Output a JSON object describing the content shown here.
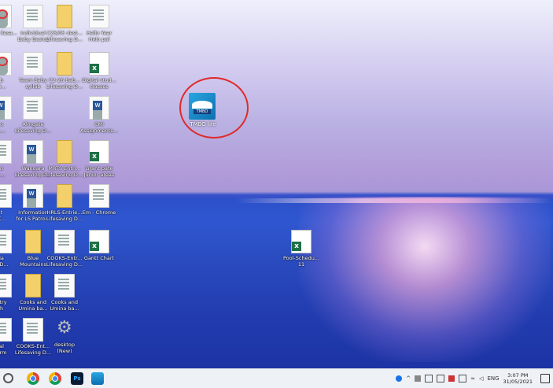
{
  "desktop": {
    "icons": [
      {
        "label": "Blu... ilesa...",
        "type": "pdf",
        "col": 0,
        "row": 0
      },
      {
        "label": "Individual\nBaby Basics",
        "type": "doc",
        "col": 1,
        "row": 0
      },
      {
        "label": "C25/05 dest...\nLifesaving D...",
        "type": "folder",
        "col": 2,
        "row": 0
      },
      {
        "label": "Hello Year\nHelo pal",
        "type": "doc",
        "col": 3,
        "row": 0
      },
      {
        "label": "b\nG...",
        "type": "pdf",
        "col": 0,
        "row": 1
      },
      {
        "label": "Team Baby\nsyllab",
        "type": "doc",
        "col": 1,
        "row": 1
      },
      {
        "label": "C2-26 Bab...\nLifesaving D...",
        "type": "folder",
        "col": 2,
        "row": 1
      },
      {
        "label": "Digital stud...\nclasses",
        "type": "xls",
        "col": 3,
        "row": 1
      },
      {
        "label": "o\nL...",
        "type": "word",
        "col": 0,
        "row": 2
      },
      {
        "label": "Almgate\nLifesaving D...",
        "type": "doc",
        "col": 1,
        "row": 2
      },
      {
        "label": "CMI\nAssignments...",
        "type": "word",
        "col": 3,
        "row": 2
      },
      {
        "label": "o\nL...",
        "type": "doc",
        "col": 0,
        "row": 3
      },
      {
        "label": "Wangara\nLifesaving D...",
        "type": "word",
        "col": 1,
        "row": 3
      },
      {
        "label": "MRTS Entri...\nLifesaving D...",
        "type": "folder",
        "col": 2,
        "row": 3
      },
      {
        "label": "Grant pate\nJunior areas",
        "type": "xls",
        "col": 3,
        "row": 3
      },
      {
        "label": "t\nK...",
        "type": "doc",
        "col": 0,
        "row": 4
      },
      {
        "label": "Information\nfor LS Patro...",
        "type": "word",
        "col": 1,
        "row": 4
      },
      {
        "label": "HRLS-Entrie...\nLifesaving D...",
        "type": "folder",
        "col": 2,
        "row": 4
      },
      {
        "label": "Em - Chrome",
        "type": "doc",
        "col": 3,
        "row": 4
      },
      {
        "label": "ia\no D...",
        "type": "doc",
        "col": 0,
        "row": 5
      },
      {
        "label": "Blue\nMountains",
        "type": "folder",
        "col": 1,
        "row": 5
      },
      {
        "label": "COOKS-Entr...\nLifesaving D...",
        "type": "doc",
        "col": 2,
        "row": 5
      },
      {
        "label": "Gantt Chart",
        "type": "xls",
        "col": 3,
        "row": 5
      },
      {
        "label": "ntry\nh",
        "type": "doc",
        "col": 0,
        "row": 6
      },
      {
        "label": "Cooks and\nUmina ba...",
        "type": "folder",
        "col": 1,
        "row": 6
      },
      {
        "label": "Cooks and\nUmina ba...",
        "type": "doc",
        "col": 2,
        "row": 6
      },
      {
        "label": "al\norm",
        "type": "doc",
        "col": 0,
        "row": 7
      },
      {
        "label": "COOKS-Ent...\nLifesaving D...",
        "type": "doc",
        "col": 1,
        "row": 7
      },
      {
        "label": "desktop\n(New)",
        "type": "gear",
        "col": 2,
        "row": 7
      }
    ],
    "floating_file": {
      "label": "Pool-Schedu...\n11"
    },
    "selected_app": {
      "label": "TMBO life",
      "badge": "TMBO"
    }
  },
  "taskbar": {
    "tray_lang": "ENG",
    "time": "3:07 PM",
    "date": "31/05/2021"
  }
}
